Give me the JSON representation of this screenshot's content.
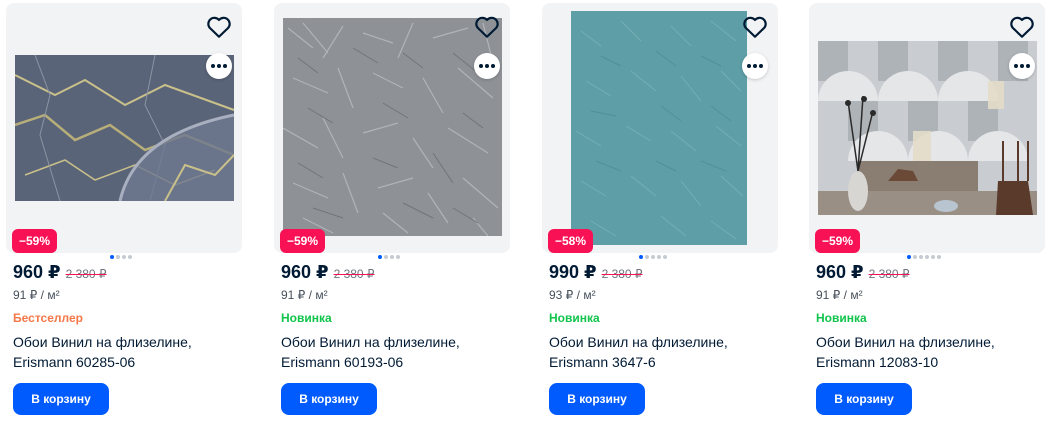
{
  "colors": {
    "accent": "#005bff",
    "discount": "#f91155",
    "bestseller": "#f57848",
    "new": "#10c44c",
    "text": "#001a34"
  },
  "icons": {
    "favorite": "heart-outline-icon",
    "more": "more-dots-icon"
  },
  "products": [
    {
      "price": "960 ₽",
      "old_price": "2 380 ₽",
      "unit_price": "91 ₽ / м²",
      "badge": "Бестселлер",
      "badge_color": "#f57848",
      "discount": "−59%",
      "title": "Обои Винил на флизелине, Erismann 60285-06",
      "button": "В корзину",
      "gallery_total": 4,
      "gallery_active": 1
    },
    {
      "price": "960 ₽",
      "old_price": "2 380 ₽",
      "unit_price": "91 ₽ / м²",
      "badge": "Новинка",
      "badge_color": "#10c44c",
      "discount": "−59%",
      "title": "Обои Винил на флизелине, Erismann 60193-06",
      "button": "В корзину",
      "gallery_total": 4,
      "gallery_active": 1
    },
    {
      "price": "990 ₽",
      "old_price": "2 380 ₽",
      "unit_price": "93 ₽ / м²",
      "badge": "Новинка",
      "badge_color": "#10c44c",
      "discount": "−58%",
      "title": "Обои Винил на флизелине, Erismann 3647-6",
      "button": "В корзину",
      "gallery_total": 5,
      "gallery_active": 1
    },
    {
      "price": "960 ₽",
      "old_price": "2 380 ₽",
      "unit_price": "91 ₽ / м²",
      "badge": "Новинка",
      "badge_color": "#10c44c",
      "discount": "−59%",
      "title": "Обои Винил на флизелине, Erismann 12083-10",
      "button": "В корзину",
      "gallery_total": 6,
      "gallery_active": 1
    }
  ]
}
